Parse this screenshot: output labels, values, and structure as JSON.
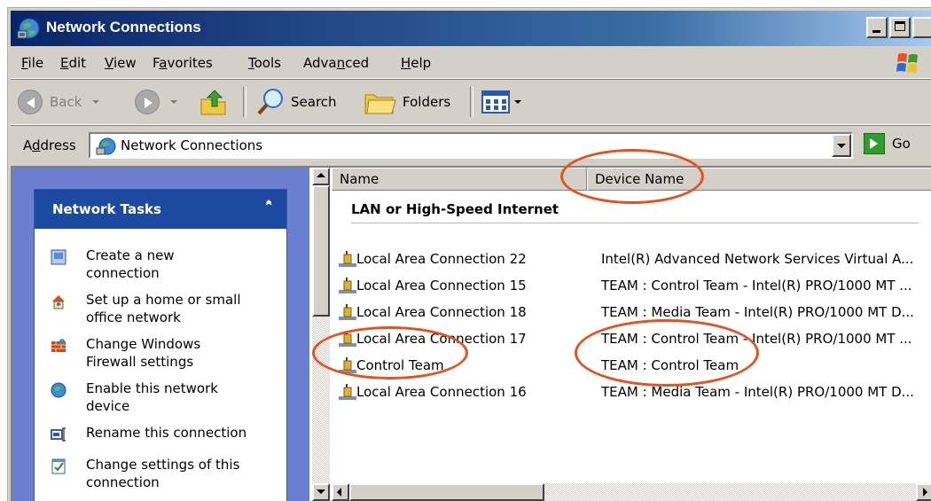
{
  "window": {
    "title": "Network Connections",
    "accent_color": "#0a246a",
    "title_icon": "network-connections-icon"
  },
  "menu": {
    "items": [
      "File",
      "Edit",
      "View",
      "Favorites",
      "Tools",
      "Advanced",
      "Help"
    ],
    "mnemonics": [
      "F",
      "E",
      "V",
      "a",
      "T",
      "n",
      "H"
    ]
  },
  "toolbar": {
    "back_label": "Back",
    "search_label": "Search",
    "folders_label": "Folders"
  },
  "address": {
    "label": "Address",
    "value": "Network Connections",
    "go_label": "Go"
  },
  "tasks": {
    "title": "Network Tasks",
    "items": [
      {
        "label_1": "Create a new",
        "label_2": "connection",
        "icon": "new-connection-icon"
      },
      {
        "label_1": "Set up a home or small",
        "label_2": "office network",
        "icon": "home-network-icon"
      },
      {
        "label_1": "Change Windows",
        "label_2": "Firewall settings",
        "icon": "firewall-icon"
      },
      {
        "label_1": "Enable this network",
        "label_2": "device",
        "icon": "enable-device-icon"
      },
      {
        "label_1": "Rename this connection",
        "label_2": "",
        "icon": "rename-icon"
      },
      {
        "label_1": "Change settings of this",
        "label_2": "connection",
        "icon": "settings-icon"
      }
    ]
  },
  "list": {
    "columns": [
      "Name",
      "Device Name"
    ],
    "group": "LAN or High-Speed Internet",
    "rows": [
      {
        "name": "Local Area Connection 22",
        "device": "Intel(R) Advanced Network Services Virtual A..."
      },
      {
        "name": "Local Area Connection 15",
        "device": "TEAM : Control Team - Intel(R) PRO/1000 MT ..."
      },
      {
        "name": "Local Area Connection 18",
        "device": "TEAM : Media Team - Intel(R) PRO/1000 MT D..."
      },
      {
        "name": "Local Area Connection 17",
        "device": "TEAM : Control Team - Intel(R) PRO/1000 MT ..."
      },
      {
        "name": "Control Team",
        "device": "TEAM : Control Team"
      },
      {
        "name": "Local Area Connection 16",
        "device": "TEAM : Media Team - Intel(R) PRO/1000 MT D..."
      }
    ]
  },
  "annotation_color": "#e8501e"
}
